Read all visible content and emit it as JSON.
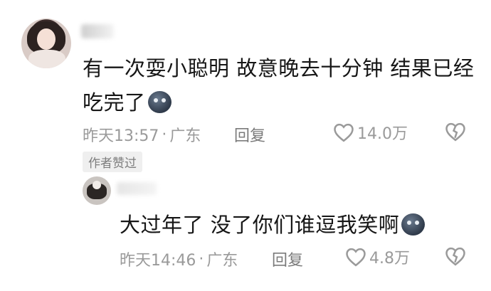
{
  "comment": {
    "text": "有一次耍小聪明 故意晚去十分钟 结果已经吃完了",
    "emoji": "dark-moon-face-emoji",
    "time": "昨天13:57",
    "dot": "·",
    "location": "广东",
    "reply_label": "回复",
    "like_count": "14.0万"
  },
  "author_badge": "作者赞过",
  "reply": {
    "text": "大过年了 没了你们谁逗我笑啊",
    "emoji": "dark-moon-face-emoji",
    "time": "昨天14:46",
    "dot": "·",
    "location": "广东",
    "reply_label": "回复",
    "like_count": "4.8万"
  },
  "colors": {
    "text": "#161616",
    "meta": "#9a9a9a",
    "badge_bg": "#efefef"
  }
}
